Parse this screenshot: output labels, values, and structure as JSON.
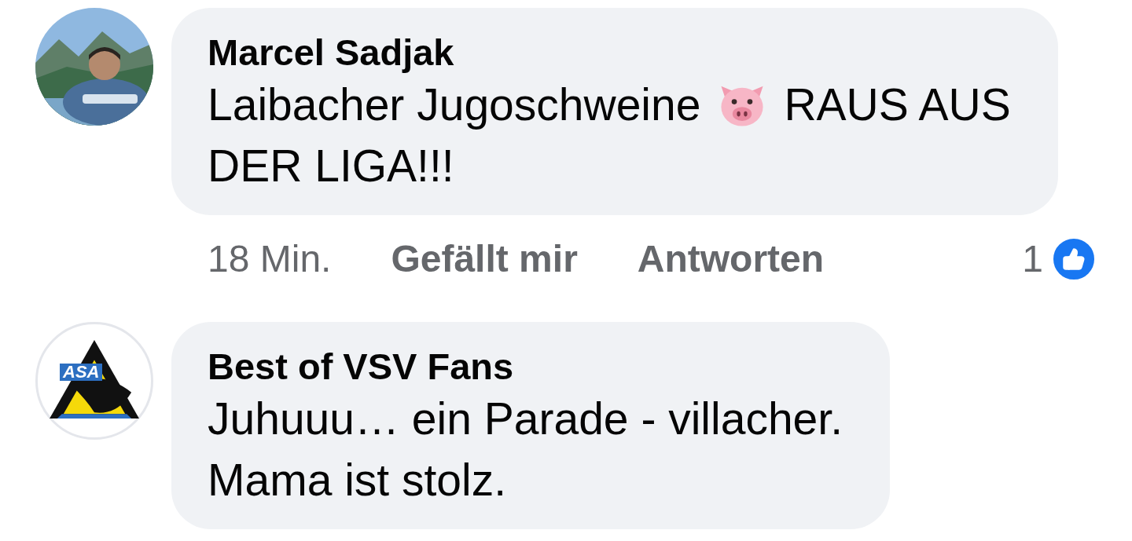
{
  "comments": [
    {
      "author": "Marcel Sadjak",
      "avatar": {
        "kind": "picture"
      },
      "lines": [
        [
          {
            "kind": "text",
            "text": "Laibacher Jugoschweine"
          },
          {
            "kind": "pig"
          },
          {
            "kind": "text",
            "text": "RAUS AUS"
          }
        ],
        [
          {
            "kind": "text",
            "text": "DER LIGA!!!"
          }
        ]
      ],
      "time": "18 Min.",
      "like_label": "Gefällt mir",
      "reply_label": "Antworten",
      "reaction_count": "1"
    },
    {
      "author": "Best of VSV Fans",
      "avatar": {
        "kind": "logo",
        "text": "ASA"
      },
      "lines": [
        [
          {
            "kind": "text",
            "text": "Juhuuu… ein Parade - villacher."
          }
        ],
        [
          {
            "kind": "text",
            "text": "Mama ist stolz."
          }
        ]
      ]
    }
  ]
}
